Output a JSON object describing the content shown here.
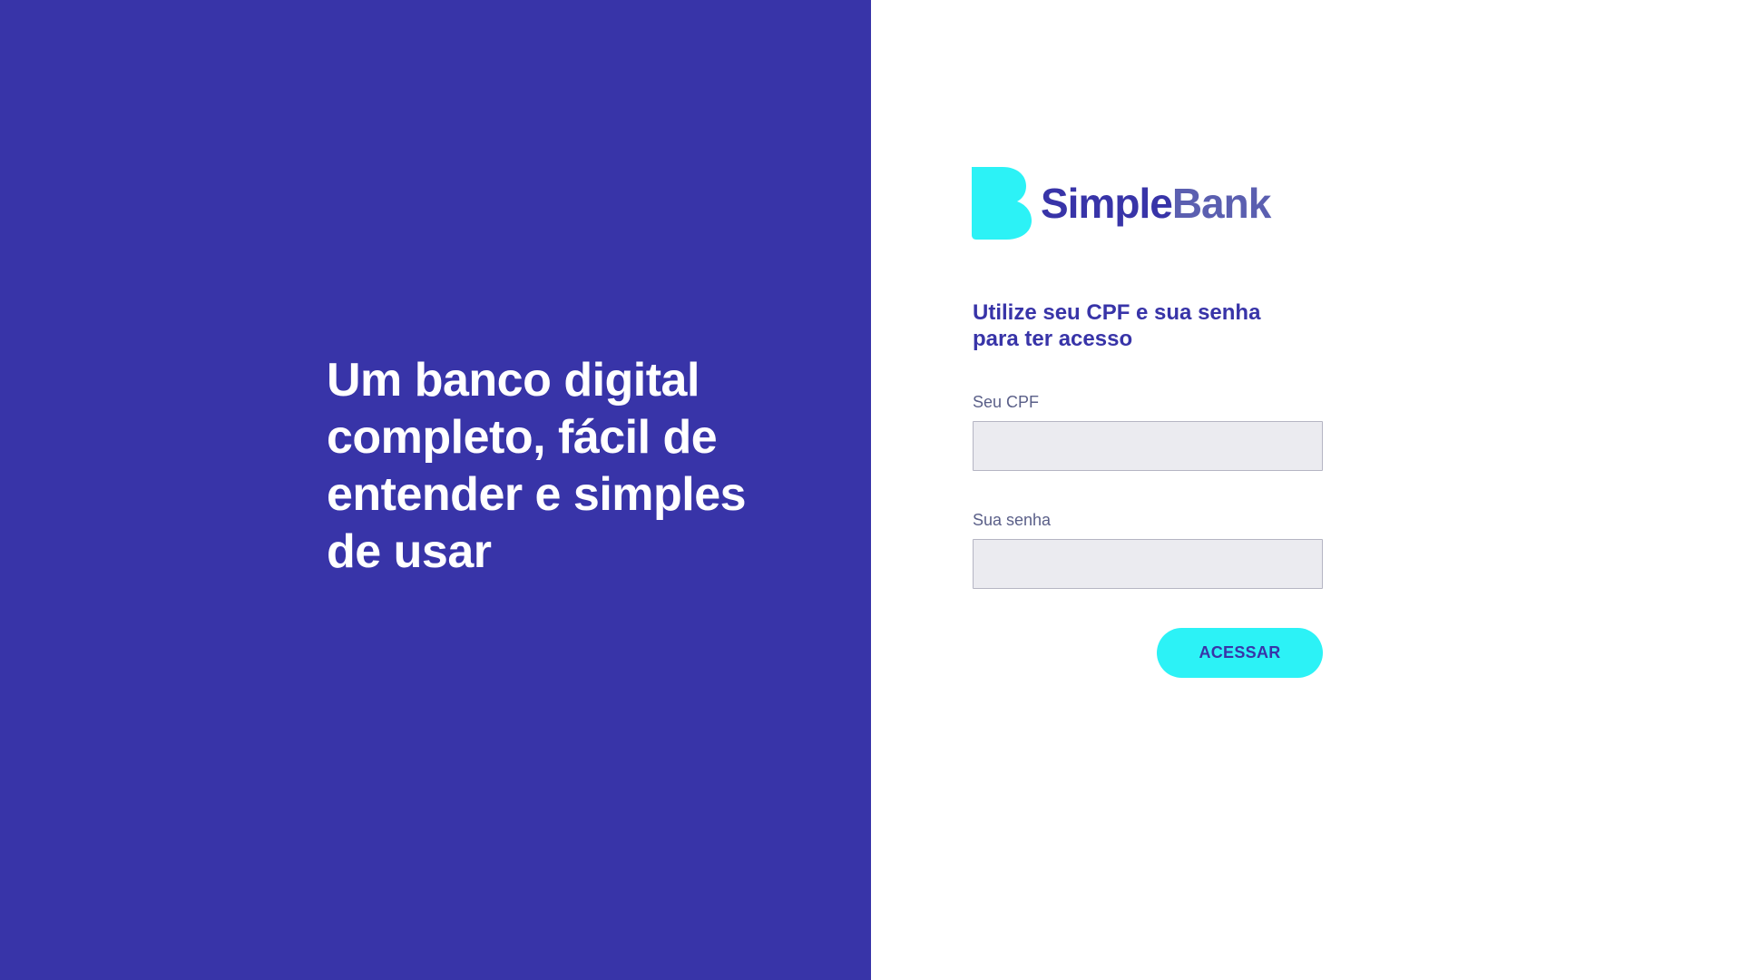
{
  "hero": {
    "tagline": "Um banco digital completo, fácil de entender e simples de usar"
  },
  "brand": {
    "name_part1": "Simple",
    "name_part2": "Bank",
    "logo_icon": "b-letter-logo-icon"
  },
  "login": {
    "subtitle": "Utilize seu CPF e sua senha para ter acesso",
    "cpf_label": "Seu CPF",
    "cpf_value": "",
    "password_label": "Sua senha",
    "password_value": "",
    "submit_label": "ACESSAR"
  },
  "colors": {
    "primary": "#3834a8",
    "accent": "#2cf2f6",
    "input_bg": "#ebebf0",
    "label": "#5a5f88",
    "bank_text": "#5b5fb0"
  }
}
